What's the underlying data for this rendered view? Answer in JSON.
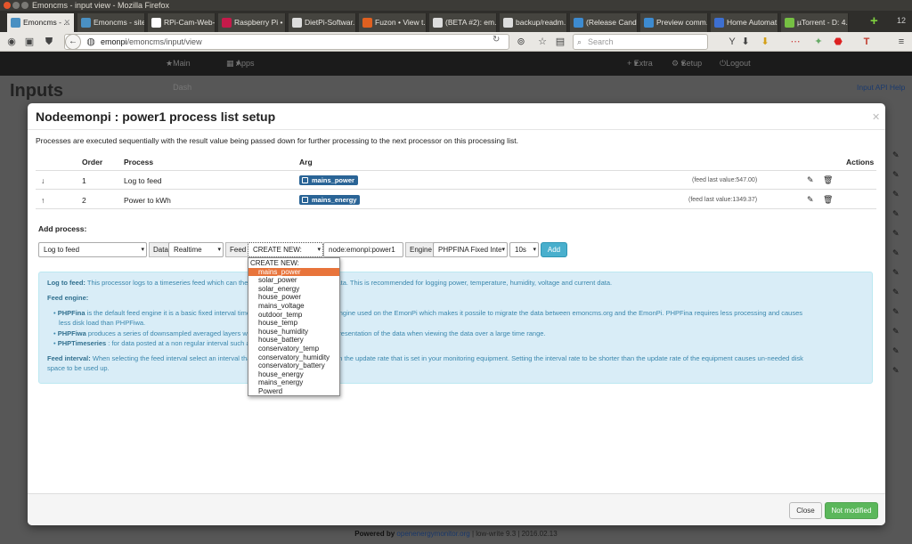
{
  "window": {
    "title": "Emoncms - input view - Mozilla Firefox"
  },
  "tabs": [
    {
      "label": "Emoncms - ...",
      "favicon": "emoncms-icon",
      "color": "#4a90c2"
    },
    {
      "label": "Emoncms - site...",
      "favicon": "emoncms-icon",
      "color": "#4a90c2"
    },
    {
      "label": "RPi-Cam-Web-I...",
      "favicon": "camera-icon",
      "color": "#ffffff"
    },
    {
      "label": "Raspberry Pi •",
      "favicon": "raspberry-icon",
      "color": "#c51a4a"
    },
    {
      "label": "DietPi-Softwar...",
      "favicon": "github-icon",
      "color": "#333333"
    },
    {
      "label": "Fuzon • View t...",
      "favicon": "forum-icon",
      "color": "#e06020"
    },
    {
      "label": "(BETA #2): em...",
      "favicon": "github-icon",
      "color": "#333333"
    },
    {
      "label": "backup/readm...",
      "favicon": "github-icon",
      "color": "#333333"
    },
    {
      "label": "(Release Candi...",
      "favicon": "discourse-icon",
      "color": "#3d8bd0"
    },
    {
      "label": "Preview comm...",
      "favicon": "discourse-icon",
      "color": "#3d8bd0"
    },
    {
      "label": "Home Automat...",
      "favicon": "m-icon",
      "color": "#3d6fd0"
    },
    {
      "label": "µTorrent - D: 4...",
      "favicon": "utorrent-icon",
      "color": "#76c043"
    }
  ],
  "tab_count": "12",
  "urlbar": {
    "host": "emonpi",
    "path": "/emoncms/input/view"
  },
  "search": {
    "placeholder": "Search"
  },
  "appnav": {
    "main_dash": "Main Dash",
    "apps": "Apps",
    "extra": "Extra",
    "setup": "Setup",
    "logout": "Logout"
  },
  "page": {
    "title": "Inputs",
    "api_help": "Input API Help",
    "footer_prefix": "Powered by",
    "footer_link": "openenergymonitor.org",
    "footer_suffix": "| low-write 9.3 | 2016.02.13"
  },
  "modal": {
    "title": "Nodeemonpi : power1 process list setup",
    "description": "Processes are executed sequentially with the result value being passed down for further processing to the next processor on this processing list.",
    "headers": {
      "order": "Order",
      "process": "Process",
      "arg": "Arg",
      "actions": "Actions"
    },
    "rows": [
      {
        "order": "1",
        "process": "Log to feed",
        "arg": "mains_power",
        "last_value": "(feed last value:547.00)"
      },
      {
        "order": "2",
        "process": "Power to kWh",
        "arg": "mains_energy",
        "last_value": "(feed last value:1349.37)"
      }
    ],
    "add_process_label": "Add process:",
    "add": {
      "process_select": "Log to feed",
      "data_label": "Data",
      "data_select": "Realtime",
      "feed_label": "Feed",
      "feed_select": "CREATE NEW:",
      "feed_name": "node:emonpi:power1",
      "engine_label": "Engine",
      "engine_select": "PHPFINA Fixed Inte",
      "interval_select": "10s",
      "add_button": "Add"
    },
    "dropdown": {
      "group": "CREATE NEW:",
      "options": [
        "mains_power",
        "solar_power",
        "solar_energy",
        "house_power",
        "mains_voltage",
        "outdoor_temp",
        "house_temp",
        "house_humidity",
        "house_battery",
        "conservatory_temp",
        "conservatory_humidity",
        "conservatory_battery",
        "house_energy",
        "mains_energy",
        "Powerd"
      ],
      "selected": "mains_power"
    },
    "info": {
      "log_title": "Log to feed:",
      "log_text": "This processor logs to a timeseries feed which can then be used to explore historic data. This is recommended for logging power, temperature, humidity, voltage and current data.",
      "engine_title": "Feed engine:",
      "bullets": [
        {
          "name": "PHPFina",
          "text": "is the default feed engine it is a basic fixed interval timeseries engine. It is the same engine used on the EmonPi which makes it possile to migrate the data between emoncms.org and the EmonPi. PHPFina requires less processing and causes"
        },
        {
          "name": "",
          "text": "less disk load than PHPFiwa."
        },
        {
          "name": "PHPFiwa",
          "text": "produces a series of downsampled averaged layers which gives a more accurate representation of the data when viewing the data over a large time range."
        },
        {
          "name": "PHPTimeseries",
          "text": ": for data posted at a non regular interval such as..."
        }
      ],
      "interval_title": "Feed interval:",
      "interval_text": "When selecting the feed interval select an interval that is the same as, or longer than the update rate that is set in your monitoring equipment. Setting the interval rate to be shorter than the update rate of the equipment causes un-needed disk",
      "interval_text2": "space to be used up."
    },
    "footer": {
      "close": "Close",
      "status": "Not modified"
    }
  },
  "colors": {
    "accent": "#e8743b",
    "badge": "#2a6496",
    "info_bg": "#d9edf7",
    "success": "#5bb75b"
  }
}
